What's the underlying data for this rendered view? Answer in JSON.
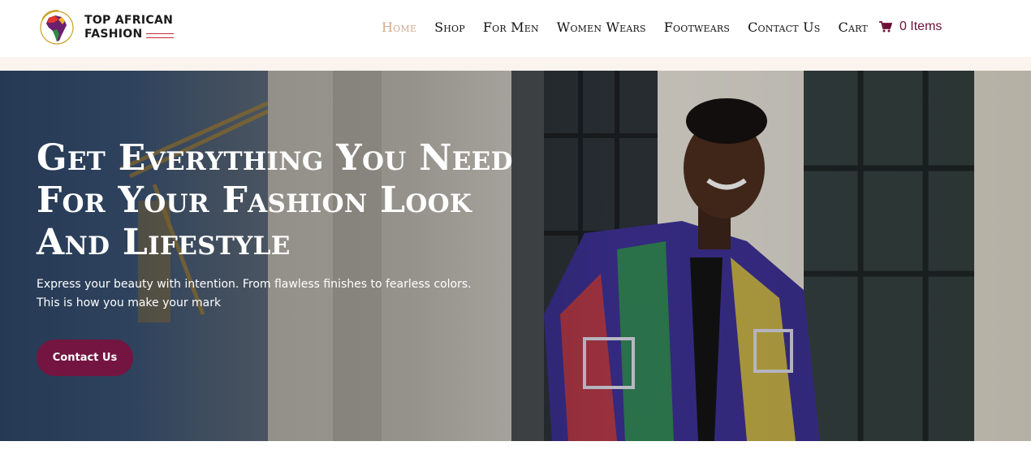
{
  "brand": {
    "logo_line1": "TOP AFRICAN",
    "logo_line2": "FASHION",
    "logo_emblem_text": "Top African Fashion"
  },
  "nav": {
    "items": [
      {
        "label": "Home",
        "active": true
      },
      {
        "label": "Shop",
        "active": false
      },
      {
        "label": "For Men",
        "active": false
      },
      {
        "label": "Women Wears",
        "active": false
      },
      {
        "label": "Footwears",
        "active": false
      },
      {
        "label": "Contact Us",
        "active": false
      },
      {
        "label": "Cart",
        "active": false
      }
    ],
    "cart_icon": "shopping-cart-icon",
    "cart_count": "0 Items"
  },
  "hero": {
    "title": "Get Everything You Need For Your Fashion Look And Lifestyle",
    "subtitle_line1": "Express your beauty with intention. From flawless finishes to fearless colors.",
    "subtitle_line2": "This is how you make your mark",
    "button_label": "Contact Us"
  },
  "colors": {
    "accent": "#741541",
    "nav_active": "#d1ab8f",
    "band": "#fbf4ee",
    "logo_red": "#c62b3a"
  }
}
